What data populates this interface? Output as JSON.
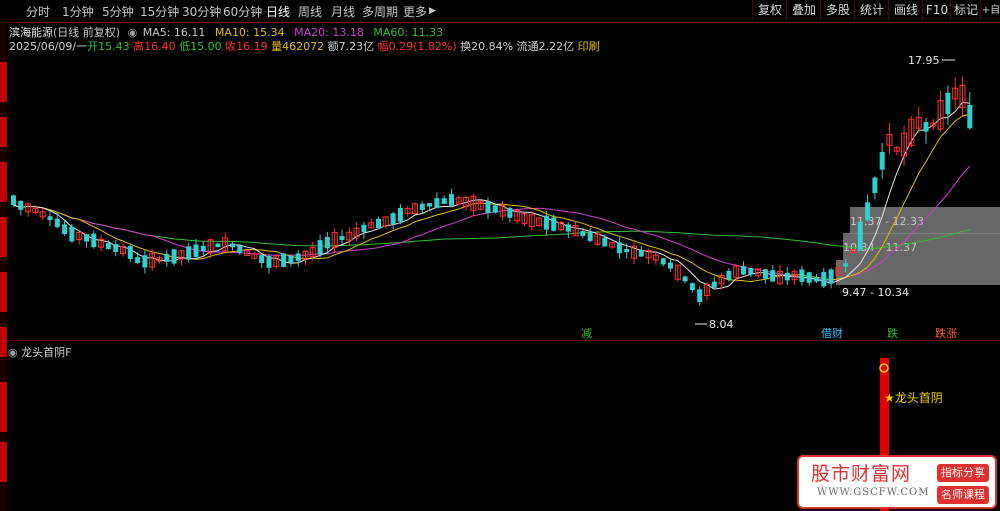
{
  "toolbar": {
    "tabs": [
      "分时",
      "1分钟",
      "5分钟",
      "15分钟",
      "30分钟",
      "60分钟",
      "日线",
      "周线",
      "月线",
      "多周期",
      "更多"
    ],
    "active_tab": "日线",
    "more_arrow": "▶",
    "right_buttons": [
      "复权",
      "叠加",
      "多股",
      "统计",
      "画线",
      "F10",
      "标记"
    ],
    "corner_icon": "+自"
  },
  "stock": {
    "name": "滨海能源",
    "mode": "(日线 前复权)",
    "ma": [
      {
        "label": "MA5: 16.11",
        "color": "#e8e8e8"
      },
      {
        "label": "MA10: 15.34",
        "color": "#e0c000"
      },
      {
        "label": "MA20: 13.18",
        "color": "#d040d0"
      },
      {
        "label": "MA60: 11.33",
        "color": "#30c030"
      }
    ]
  },
  "quote": {
    "date": "2025/06/09/一",
    "open_label": "开",
    "open": "15.43",
    "high_label": "高",
    "high": "16.40",
    "low_label": "低",
    "low": "15.00",
    "close_label": "收",
    "close": "16.19",
    "vol_label": "量",
    "vol": "462072",
    "amt_label": "额",
    "amt": "7.23亿",
    "chg_label": "幅",
    "chg": "0.29(1.82%)",
    "turnover": "换20.84%",
    "float": "流通2.22亿",
    "seal": "印刷"
  },
  "chart_data": {
    "type": "candlestick",
    "price_labels": {
      "high": "17.95",
      "low": "8.04"
    },
    "ranges": [
      "11.37 - 12.33",
      "10.34 - 11.37",
      "9.47 - 10.34"
    ],
    "markers": [
      {
        "text": "减",
        "color": "#30c030"
      },
      {
        "text": "借财",
        "color": "#30c0ff"
      },
      {
        "text": "跌",
        "color": "#30c030"
      },
      {
        "text": "跌涨",
        "color": "#ff6040"
      }
    ],
    "ma_colors": {
      "ma5": "#e8e8e8",
      "ma10": "#e0c000",
      "ma20": "#d040d0",
      "ma60": "#30c030"
    }
  },
  "indicator": {
    "title": "龙头首阴F",
    "signal": "★龙头首阴",
    "signal_color": "#f0d000"
  },
  "watermark": {
    "title": "股市财富网",
    "url": "WWW.GSCFW.COM",
    "tag1": "指标分享",
    "tag2": "名师课程"
  },
  "colors": {
    "up": "#ff3030",
    "down": "#30d0d0",
    "accent": "#c00000"
  }
}
